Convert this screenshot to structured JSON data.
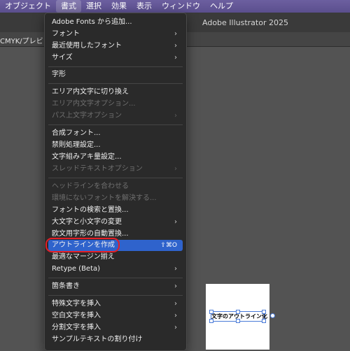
{
  "menubar": {
    "items": [
      "オブジェクト",
      "書式",
      "選択",
      "効果",
      "表示",
      "ウィンドウ",
      "ヘルプ"
    ]
  },
  "app": {
    "title": "Adobe Illustrator 2025"
  },
  "document": {
    "tab_label": "CMYK/プレビュー"
  },
  "menu": {
    "items": [
      {
        "label": "Adobe Fonts から追加...",
        "enabled": true
      },
      {
        "label": "フォント",
        "enabled": true,
        "submenu": true
      },
      {
        "label": "最近使用したフォント",
        "enabled": true,
        "submenu": true
      },
      {
        "label": "サイズ",
        "enabled": true,
        "submenu": true
      },
      {
        "label": "字形",
        "enabled": true
      },
      {
        "label": "エリア内文字に切り換え",
        "enabled": true
      },
      {
        "label": "エリア内文字オプション...",
        "enabled": false
      },
      {
        "label": "パス上文字オプション",
        "enabled": false,
        "submenu": true
      },
      {
        "label": "合成フォント...",
        "enabled": true
      },
      {
        "label": "禁則処理設定...",
        "enabled": true
      },
      {
        "label": "文字組みアキ量設定...",
        "enabled": true
      },
      {
        "label": "スレッドテキストオプション",
        "enabled": false,
        "submenu": true
      },
      {
        "label": "ヘッドラインを合わせる",
        "enabled": false
      },
      {
        "label": "環境にないフォントを解決する...",
        "enabled": false
      },
      {
        "label": "フォントの検索と置換...",
        "enabled": true
      },
      {
        "label": "大文字と小文字の変更",
        "enabled": true,
        "submenu": true
      },
      {
        "label": "欧文用字形の自動置換...",
        "enabled": true
      },
      {
        "label": "アウトラインを作成",
        "enabled": true,
        "shortcut": "⇧⌘O",
        "highlighted": true
      },
      {
        "label": "最適なマージン揃え",
        "enabled": true
      },
      {
        "label": "Retype (Beta)",
        "enabled": true,
        "submenu": true
      },
      {
        "label": "箇条書き",
        "enabled": true,
        "submenu": true
      },
      {
        "label": "特殊文字を挿入",
        "enabled": true,
        "submenu": true
      },
      {
        "label": "空白文字を挿入",
        "enabled": true,
        "submenu": true
      },
      {
        "label": "分割文字を挿入",
        "enabled": true,
        "submenu": true
      },
      {
        "label": "サンプルテキストの割り付け",
        "enabled": true
      }
    ]
  },
  "artboard": {
    "text": "文字のアウトライン化"
  },
  "colors": {
    "menubar": "#5b4f8e",
    "highlight": "#2f63cc",
    "callout": "#e51e25",
    "selection": "#4a7bd8"
  },
  "icons": {
    "submenu": "chevron-right-icon"
  }
}
